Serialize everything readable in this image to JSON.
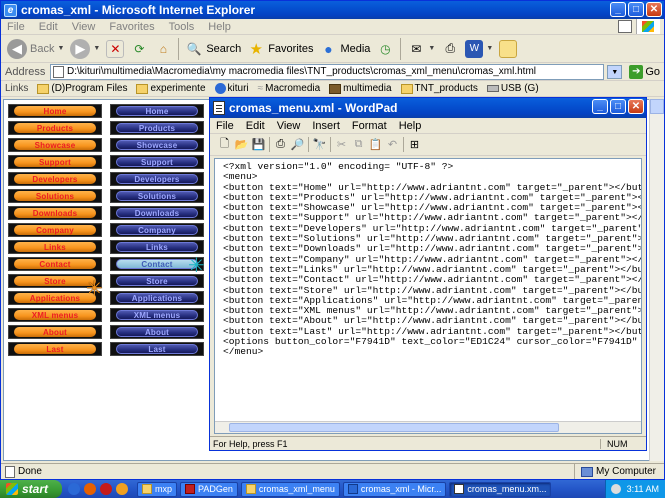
{
  "ie": {
    "title": "cromas_xml - Microsoft Internet Explorer",
    "app_icon": "e",
    "window_buttons": [
      "_",
      "□",
      "✕"
    ],
    "menu": [
      "File",
      "Edit",
      "View",
      "Favorites",
      "Tools",
      "Help"
    ],
    "toolbar": {
      "back": "Back",
      "search": "Search",
      "favorites": "Favorites",
      "media": "Media"
    },
    "address_label": "Address",
    "address": "D:\\kituri\\multimedia\\Macromedia\\my macromedia files\\TNT_products\\cromas_xml_menu\\cromas_xml.html",
    "go": "Go",
    "links_label": "Links",
    "links": [
      "(D)Program Files",
      "experimente",
      "kituri",
      "Macromedia",
      "multimedia",
      "TNT_products",
      "USB (G)"
    ],
    "status_text": "Done",
    "zone": "My Computer"
  },
  "menus": {
    "items": [
      "Home",
      "Products",
      "Showcase",
      "Support",
      "Developers",
      "Solutions",
      "Downloads",
      "Company",
      "Links",
      "Contact",
      "Store",
      "Applications",
      "XML menus",
      "About",
      "Last"
    ],
    "blue_hover_index": 9,
    "button_color": "#F7941D",
    "text_color": "#ED1C24"
  },
  "wordpad": {
    "title": "cromas_menu.xml - WordPad",
    "window_buttons": [
      "_",
      "□",
      "✕"
    ],
    "menu": [
      "File",
      "Edit",
      "View",
      "Insert",
      "Format",
      "Help"
    ],
    "content": "<?xml version=\"1.0\" encoding= \"UTF-8\" ?>\n<menu>\n<button text=\"Home\" url=\"http://www.adriantnt.com\" target=\"_parent\"></button>\n<button text=\"Products\" url=\"http://www.adriantnt.com\" target=\"_parent\"></button>\n<button text=\"Showcase\" url=\"http://www.adriantnt.com\" target=\"_parent\"></button>\n<button text=\"Support\" url=\"http://www.adriantnt.com\" target=\"_parent\"></button>\n<button text=\"Developers\" url=\"http://www.adriantnt.com\" target=\"_parent\"></button>\n<button text=\"Solutions\" url=\"http://www.adriantnt.com\" target=\"_parent\"></button>\n<button text=\"Downloads\" url=\"http://www.adriantnt.com\" target=\"_parent\"></button>\n<button text=\"Company\" url=\"http://www.adriantnt.com\" target=\"_parent\"></button>\n<button text=\"Links\" url=\"http://www.adriantnt.com\" target=\"_parent\"></button>\n<button text=\"Contact\" url=\"http://www.adriantnt.com\" target=\"_parent\"></button>\n<button text=\"Store\" url=\"http://www.adriantnt.com\" target=\"_parent\"></button>\n<button text=\"Applications\" url=\"http://www.adriantnt.com\" target=\"_parent\"></button>\n<button text=\"XML menus\" url=\"http://www.adriantnt.com\" target=\"_parent\"></button>\n<button text=\"About\" url=\"http://www.adriantnt.com\" target=\"_parent\"></button>\n<button text=\"Last\" url=\"http://www.adriantnt.com\" target=\"_parent\"></button>\n<options button_color=\"F7941D\" text_color=\"ED1C24\" cursor_color=\"F7941D\" custom_cu\n</menu>",
    "status": "For Help, press F1",
    "num": "NUM"
  },
  "taskbar": {
    "start": "start",
    "tasks": [
      "mxp",
      "PADGen",
      "cromas_xml_menu",
      "cromas_xml - Micr...",
      "cromas_menu.xm..."
    ],
    "active_index": 4,
    "time": "3:11 AM"
  }
}
